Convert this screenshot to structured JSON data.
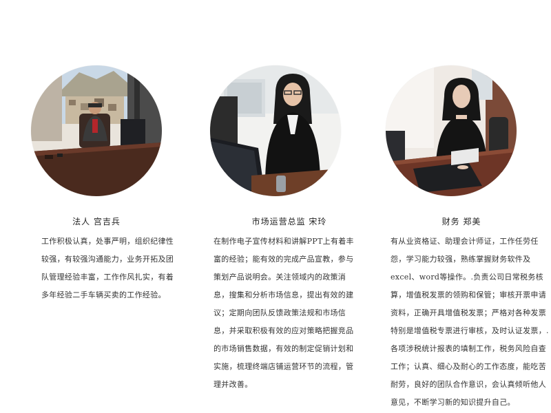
{
  "profiles": [
    {
      "name_line": "法人 宫吉兵",
      "description": "工作积极认真，处事严明，组织纪律性较强，有较强沟通能力，业务开拓及团队管理经验丰富，工作作风扎实，有着多年经验二手车辆买卖的工作经验。"
    },
    {
      "name_line": "市场运营总监 宋玲",
      "description": "在制作电子宣传材料和讲解PPT上有着丰富的经验；能有效的完成产品宣教，参与策划产品说明会。关注领域内的政策消息，搜集和分析市场信息，提出有效的建议；定期向团队反馈政策法规和市场信息，并采取积极有效的应对策略把握竞品的市场销售数据，有效的制定促销计划和实施，梳理终端店铺运营环节的流程，管理并改善。"
    },
    {
      "name_line": "财务 郑美",
      "description": "有从业资格证、助理会计师证，工作任劳任怨，学习能力较强，熟练掌握财务软件及excel、word等操作。.负责公司日常税务核算，增值税发票的领购和保管；审核开票申请资料，正确开具增值税发票；严格对各种发票特别是增值税专票进行审核，及时认证发票，.各项涉税统计报表的填制工作，税务风险自查工作；认真、细心及耐心的工作态度，能吃苦耐劳，良好的团队合作意识，会认真倾听他人意见，不断学习新的知识提升自己。"
    }
  ]
}
